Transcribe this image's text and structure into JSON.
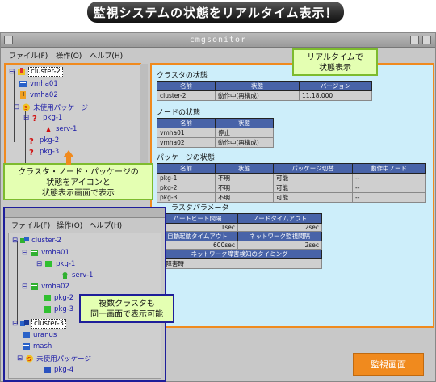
{
  "banner": {
    "title": "監視システムの状態をリアルタイム表示！"
  },
  "main_window": {
    "title": "cmgsonitor",
    "menu": [
      "ファイル(F)",
      "操作(O)",
      "ヘルプ(H)"
    ],
    "tree": {
      "root": "cluster-2",
      "nodes": [
        "vmha01",
        "vmha02"
      ],
      "unused_group": "未使用パッケージ",
      "packages": [
        "pkg-1",
        "pkg-2",
        "pkg-3"
      ],
      "service": "serv-1"
    }
  },
  "status_panel": {
    "cluster": {
      "heading": "クラスタの状態",
      "headers": [
        "名前",
        "状態",
        "バージョン"
      ],
      "rows": [
        [
          "cluster-2",
          "動作中(再構成)",
          "11.18.000"
        ]
      ]
    },
    "node": {
      "heading": "ノードの状態",
      "headers": [
        "名前",
        "状態"
      ],
      "rows": [
        [
          "vmha01",
          "停止"
        ],
        [
          "vmha02",
          "動作中(再構成)"
        ]
      ]
    },
    "package": {
      "heading": "パッケージの状態",
      "headers": [
        "名前",
        "状態",
        "パッケージ切替",
        "動作中ノード"
      ],
      "rows": [
        [
          "pkg-1",
          "不明",
          "可能",
          "--"
        ],
        [
          "pkg-2",
          "不明",
          "可能",
          "--"
        ],
        [
          "pkg-3",
          "不明",
          "可能",
          "--"
        ]
      ]
    },
    "params": {
      "heading": "ラスタパラメータ",
      "h1": "ハートビート間隔",
      "h2": "ノードタイムアウト",
      "v1": "1sec",
      "v2": "2sec",
      "h3": "自動起動タイムアウト",
      "h4": "ネットワーク監視間隔",
      "v3": "600sec",
      "v4": "2sec",
      "h5": "ネットワーク障害検知のタイミング",
      "v5": "即障害時"
    }
  },
  "callouts": {
    "realtime": "リアルタイムで\n状態表示",
    "icons": "クラスタ・ノード・パッケージの\n状態をアイコンと\n状態表示画面で表示",
    "multi": "複数クラスタも\n同一画面で表示可能"
  },
  "monitor_button": "監視画面",
  "second_window": {
    "menu": [
      "ファイル(F)",
      "操作(O)",
      "ヘルプ(H)"
    ],
    "tree": {
      "cluster_a": "cluster-2",
      "node_a1": "vmha01",
      "pkg_a1": "pkg-1",
      "serv": "serv-1",
      "node_a2": "vmha02",
      "pkg_a2": "pkg-2",
      "pkg_a3": "pkg-3",
      "cluster_b": "cluster-3",
      "node_b1": "uranus",
      "node_b2": "mash",
      "unused": "未使用パッケージ",
      "pkg_b": "pkg-4"
    }
  },
  "colors": {
    "accent_orange": "#f08a1e",
    "panel_blue": "#cdeefa",
    "header_blue": "#4863a8",
    "callout_green": "#e4ffb2"
  }
}
